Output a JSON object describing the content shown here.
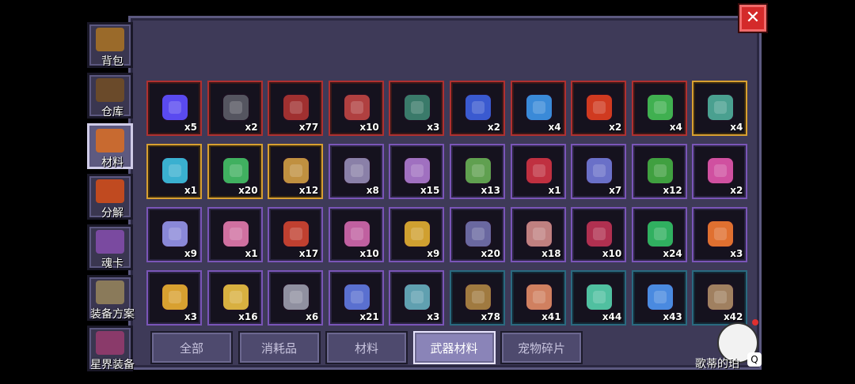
{
  "close": {
    "icon": "close-x-icon",
    "label": "✕"
  },
  "sidebar": {
    "items": [
      {
        "label": "背包",
        "icon": "chest-icon",
        "color": "#9a6a2a"
      },
      {
        "label": "仓库",
        "icon": "storage-icon",
        "color": "#6a4a2a"
      },
      {
        "label": "材料",
        "icon": "materials-icon",
        "color": "#c86a30",
        "active": true
      },
      {
        "label": "分解",
        "icon": "decompose-icon",
        "color": "#c04a20"
      },
      {
        "label": "魂卡",
        "icon": "soul-card-icon",
        "color": "#7a4aa0"
      },
      {
        "label": "装备方案",
        "icon": "armor-icon",
        "color": "#8a7a5a"
      },
      {
        "label": "星界装备",
        "icon": "astral-gear-icon",
        "color": "#8a3a6a"
      }
    ]
  },
  "grid": {
    "items": [
      {
        "count": "x5",
        "rarity": "red",
        "color": "#5a4af0"
      },
      {
        "count": "x2",
        "rarity": "red",
        "color": "#555560"
      },
      {
        "count": "x77",
        "rarity": "red",
        "color": "#a03030"
      },
      {
        "count": "x10",
        "rarity": "red",
        "color": "#b04040"
      },
      {
        "count": "x3",
        "rarity": "red",
        "color": "#3a7a6a"
      },
      {
        "count": "x2",
        "rarity": "red",
        "color": "#3a5ad0"
      },
      {
        "count": "x4",
        "rarity": "red",
        "color": "#3a8ad8"
      },
      {
        "count": "x2",
        "rarity": "red",
        "color": "#d03a20"
      },
      {
        "count": "x4",
        "rarity": "red",
        "color": "#40b050"
      },
      {
        "count": "x4",
        "rarity": "gold",
        "color": "#4aa090"
      },
      {
        "count": "x1",
        "rarity": "gold",
        "color": "#3ab0d0"
      },
      {
        "count": "x20",
        "rarity": "gold",
        "color": "#40b060"
      },
      {
        "count": "x12",
        "rarity": "gold",
        "color": "#c09040"
      },
      {
        "count": "x8",
        "rarity": "purple",
        "color": "#8a80a8"
      },
      {
        "count": "x15",
        "rarity": "purple",
        "color": "#a070c0"
      },
      {
        "count": "x13",
        "rarity": "purple",
        "color": "#60a050"
      },
      {
        "count": "x1",
        "rarity": "purple",
        "color": "#c03040"
      },
      {
        "count": "x7",
        "rarity": "purple",
        "color": "#6a70c8"
      },
      {
        "count": "x12",
        "rarity": "purple",
        "color": "#40a040"
      },
      {
        "count": "x2",
        "rarity": "purple",
        "color": "#d050a0"
      },
      {
        "count": "x9",
        "rarity": "purple",
        "color": "#8a88d8"
      },
      {
        "count": "x1",
        "rarity": "purple",
        "color": "#d070a0"
      },
      {
        "count": "x17",
        "rarity": "purple",
        "color": "#c04030"
      },
      {
        "count": "x10",
        "rarity": "purple",
        "color": "#c060a0"
      },
      {
        "count": "x9",
        "rarity": "purple",
        "color": "#d0a030"
      },
      {
        "count": "x20",
        "rarity": "purple",
        "color": "#6a68a0"
      },
      {
        "count": "x18",
        "rarity": "purple",
        "color": "#c08080"
      },
      {
        "count": "x10",
        "rarity": "purple",
        "color": "#b03050"
      },
      {
        "count": "x24",
        "rarity": "purple",
        "color": "#30b060"
      },
      {
        "count": "x3",
        "rarity": "purple",
        "color": "#e07030"
      },
      {
        "count": "x3",
        "rarity": "purple",
        "color": "#d8a030"
      },
      {
        "count": "x16",
        "rarity": "purple",
        "color": "#d8b040"
      },
      {
        "count": "x6",
        "rarity": "purple",
        "color": "#9090a0"
      },
      {
        "count": "x21",
        "rarity": "purple",
        "color": "#5a70d0"
      },
      {
        "count": "x3",
        "rarity": "purple",
        "color": "#60a0b0"
      },
      {
        "count": "x78",
        "rarity": "teal",
        "color": "#a07a40"
      },
      {
        "count": "x41",
        "rarity": "teal",
        "color": "#d08060"
      },
      {
        "count": "x44",
        "rarity": "teal",
        "color": "#50c0a0"
      },
      {
        "count": "x43",
        "rarity": "teal",
        "color": "#4a8ae0"
      },
      {
        "count": "x42",
        "rarity": "teal",
        "color": "#a08060"
      }
    ]
  },
  "bottom_tabs": [
    {
      "label": "全部"
    },
    {
      "label": "消耗品"
    },
    {
      "label": "材料"
    },
    {
      "label": "武器材料",
      "active": true
    },
    {
      "label": "宠物碎片"
    }
  ],
  "user": {
    "name": "歌蒂的珀",
    "badge": "Q"
  }
}
